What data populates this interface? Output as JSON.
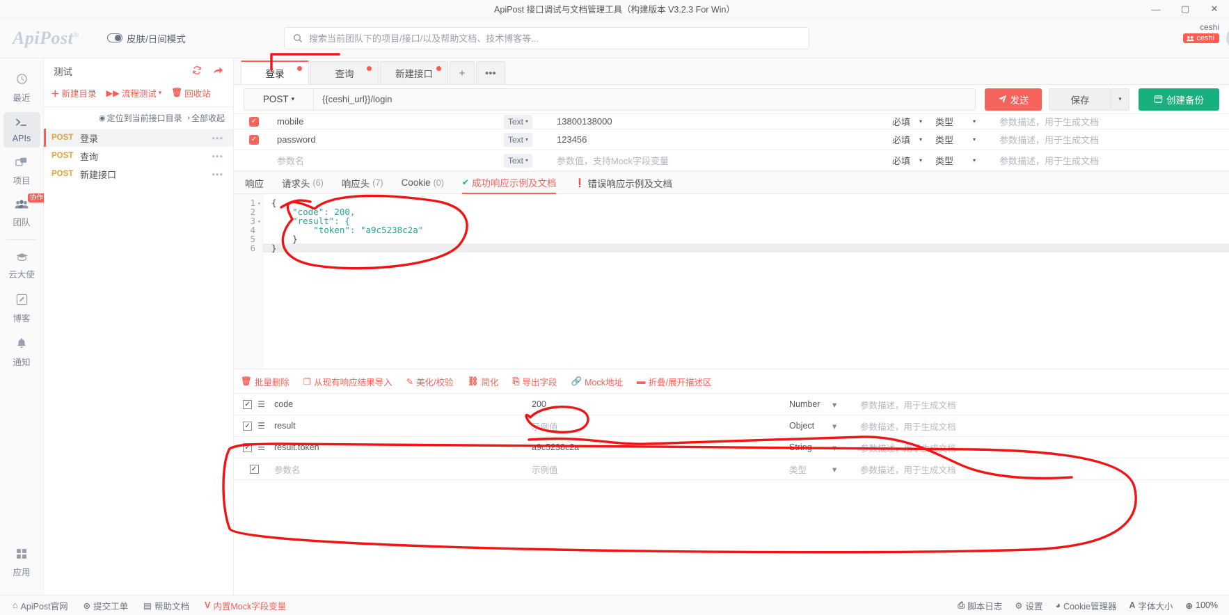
{
  "window": {
    "title": "ApiPost 接口调试与文档管理工具（构建版本 V3.2.3 For Win）",
    "minimize": "—",
    "maximize": "▢",
    "close": "✕"
  },
  "header": {
    "logo": "ApiPost",
    "logo_sup": "®",
    "skin_label": "皮肤/日间模式",
    "search_placeholder": "搜索当前团队下的项目/接口/以及帮助文档、技术博客等...",
    "search_value": "",
    "user_name": "ceshi",
    "user_badge": "ceshi"
  },
  "rail": {
    "items": [
      {
        "label": "最近",
        "icon": "clock-icon",
        "active": false
      },
      {
        "label": "APIs",
        "icon": "terminal-icon",
        "active": true
      },
      {
        "label": "项目",
        "icon": "project-icon",
        "active": false
      },
      {
        "label": "团队",
        "icon": "team-icon",
        "active": false,
        "badge": "协作"
      },
      {
        "label": "云大使",
        "icon": "graduation-icon",
        "active": false
      },
      {
        "label": "博客",
        "icon": "pencil-icon",
        "active": false
      },
      {
        "label": "通知",
        "icon": "bell-icon",
        "active": false
      }
    ],
    "bottom": {
      "label": "应用",
      "icon": "grid-icon"
    }
  },
  "project": {
    "name": "测试",
    "refresh_icon": "refresh-icon",
    "share_icon": "share-icon",
    "tools": [
      {
        "label": "新建目录",
        "icon": "plus-icon"
      },
      {
        "label": "流程测试",
        "icon": "flow-icon",
        "caret": "▾"
      },
      {
        "label": "回收站",
        "icon": "trash-icon"
      }
    ],
    "subtools": [
      {
        "label": "定位到当前接口目录",
        "icon": "locate-icon"
      },
      {
        "label": "全部收起",
        "icon": "chevron-right-icon"
      }
    ],
    "apis": [
      {
        "method": "POST",
        "name": "登录",
        "active": true,
        "more": "•••"
      },
      {
        "method": "POST",
        "name": "查询",
        "active": false,
        "more": "•••"
      },
      {
        "method": "POST",
        "name": "新建接口",
        "active": false,
        "more": "•••"
      }
    ]
  },
  "tabs": [
    {
      "label": "登录",
      "active": true,
      "dirty": true
    },
    {
      "label": "查询",
      "active": false,
      "dirty": true
    },
    {
      "label": "新建接口",
      "active": false,
      "dirty": true
    },
    {
      "label": "+",
      "active": false,
      "kind": "add"
    },
    {
      "label": "•••",
      "active": false,
      "kind": "more"
    }
  ],
  "request": {
    "method": "POST",
    "method_caret": "▾",
    "url": "{{ceshi_url}}/login",
    "send_label": "发送",
    "send_icon": "send-icon",
    "save_label": "保存",
    "save_caret": "▾",
    "backup_label": "创建备份",
    "backup_icon": "backup-icon"
  },
  "params": {
    "rows": [
      {
        "checked": true,
        "name": "mobile",
        "type": "Text",
        "value": "13800138000",
        "required": "必填",
        "datatype": "类型",
        "desc": "参数描述，用于生成文档",
        "muted": false
      },
      {
        "checked": true,
        "name": "password",
        "type": "Text",
        "value": "123456",
        "required": "必填",
        "datatype": "类型",
        "desc": "参数描述，用于生成文档",
        "muted": false
      },
      {
        "checked": false,
        "name": "参数名",
        "type": "Text",
        "value": "参数值，支持Mock字段变量",
        "required": "必填",
        "datatype": "类型",
        "desc": "参数描述，用于生成文档",
        "muted": true
      }
    ]
  },
  "response_tabs": [
    {
      "label": "响应",
      "count": null,
      "active": false,
      "icon": null
    },
    {
      "label": "请求头",
      "count": "(6)",
      "active": false,
      "icon": null
    },
    {
      "label": "响应头",
      "count": "(7)",
      "active": false,
      "icon": null
    },
    {
      "label": "Cookie",
      "count": "(0)",
      "active": false,
      "icon": null
    },
    {
      "label": "成功响应示例及文档",
      "count": null,
      "active": true,
      "icon": "check-circle-icon"
    },
    {
      "label": "错误响应示例及文档",
      "count": null,
      "active": false,
      "icon": "error-circle-icon"
    }
  ],
  "editor": {
    "lines": [
      {
        "no": "1",
        "fold": "▾",
        "text": "{"
      },
      {
        "no": "2",
        "fold": "",
        "text": "    \"code\": 200,"
      },
      {
        "no": "3",
        "fold": "▾",
        "text": "    \"result\": {"
      },
      {
        "no": "4",
        "fold": "",
        "text": "        \"token\": \"a9c5238c2a\""
      },
      {
        "no": "5",
        "fold": "",
        "text": "    }"
      },
      {
        "no": "6",
        "fold": "",
        "text": "}"
      }
    ],
    "raw": "{\n    \"code\": 200,\n    \"result\": {\n        \"token\": \"a9c5238c2a\"\n    }\n}"
  },
  "field_toolbar": [
    {
      "label": "批量删除",
      "icon": "trash-icon"
    },
    {
      "label": "从现有响应结果导入",
      "icon": "import-icon"
    },
    {
      "label": "美化/校验",
      "icon": "wand-icon"
    },
    {
      "label": "简化",
      "icon": "simplify-icon"
    },
    {
      "label": "导出字段",
      "icon": "export-icon"
    },
    {
      "label": "Mock地址",
      "icon": "link-icon"
    },
    {
      "label": "折叠/展开描述区",
      "icon": "minus-icon"
    }
  ],
  "fields": {
    "rows": [
      {
        "checked": true,
        "drag": true,
        "name": "code",
        "value": "200",
        "type": "Number",
        "caret": "▾",
        "desc": "参数描述，用于生成文档",
        "muted": false
      },
      {
        "checked": true,
        "drag": true,
        "name": "result",
        "value": "示例值",
        "type": "Object",
        "caret": "▾",
        "desc": "参数描述，用于生成文档",
        "muted": true
      },
      {
        "checked": true,
        "drag": true,
        "name": "result.token",
        "value": "a9c5238c2a",
        "type": "String",
        "caret": "▾",
        "desc": "参数描述，用于生成文档",
        "muted": false
      },
      {
        "checked": true,
        "drag": false,
        "name": "参数名",
        "value": "示例值",
        "type": "类型",
        "caret": "▾",
        "desc": "参数描述，用于生成文档",
        "muted": true
      }
    ]
  },
  "footer": {
    "left": [
      {
        "label": "ApiPost官网",
        "icon": "home-icon",
        "accent": false
      },
      {
        "label": "提交工单",
        "icon": "ticket-icon",
        "accent": false
      },
      {
        "label": "帮助文档",
        "icon": "book-icon",
        "accent": false
      },
      {
        "label": "内置Mock字段变量",
        "icon": "mock-icon",
        "accent": true
      }
    ],
    "right": [
      {
        "label": "脚本日志",
        "icon": "log-icon",
        "accent": false
      },
      {
        "label": "设置",
        "icon": "gear-icon",
        "accent": false
      },
      {
        "label": "Cookie管理器",
        "icon": "cookie-icon",
        "accent": false
      },
      {
        "label": "字体大小",
        "icon": "font-icon",
        "accent": false
      },
      {
        "label": "100%",
        "icon": "zoom-icon",
        "accent": false
      }
    ]
  },
  "colors": {
    "accent": "#ff5b52",
    "send": "#f4645c",
    "backup": "#18b07f",
    "annotation": "#f01414"
  }
}
